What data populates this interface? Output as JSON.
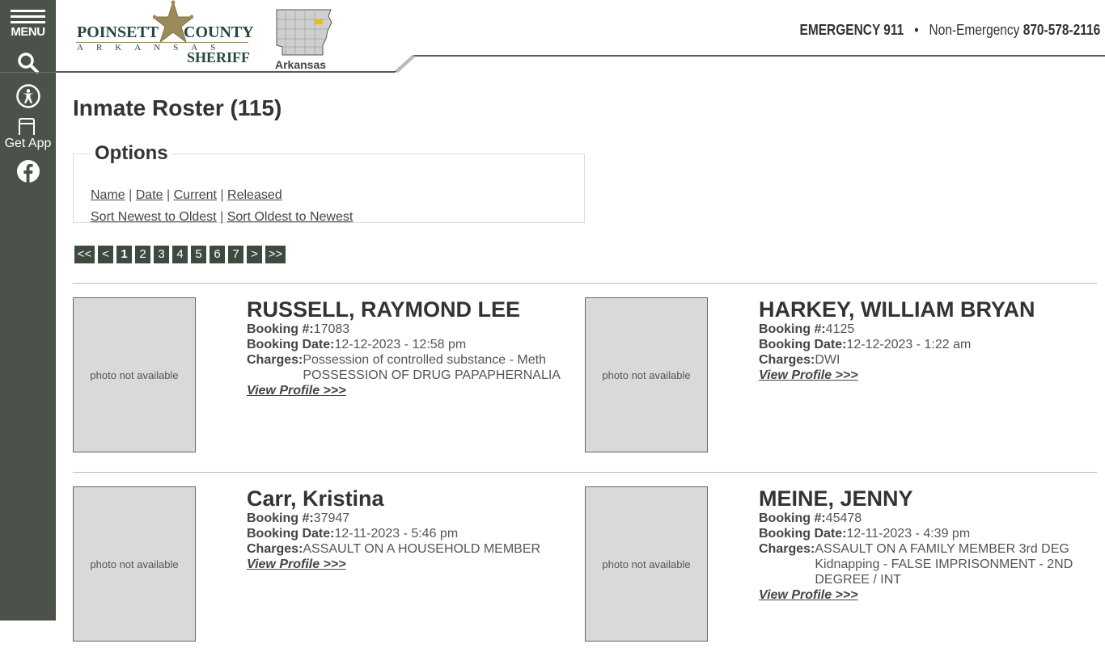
{
  "sidebar": {
    "menu_label": "MENU",
    "app_label": "Get App"
  },
  "header": {
    "logo": {
      "line1_left": "POINSETT",
      "line1_right": "COUNTY",
      "line2": "ARKANSAS",
      "line3": "SHERIFF"
    },
    "state_label": "Arkansas",
    "emergency_label": "EMERGENCY 911",
    "separator": "•",
    "non_emergency_label": "Non-Emergency",
    "non_emergency_number": "870-578-2116"
  },
  "page": {
    "title": "Inmate Roster (115)"
  },
  "options": {
    "legend": "Options",
    "filters": [
      "Name",
      "Date",
      "Current",
      "Released"
    ],
    "sorts": [
      "Sort Newest to Oldest",
      "Sort Oldest to Newest"
    ],
    "divider": "|"
  },
  "pager": {
    "items": [
      "<<",
      "<",
      "1",
      "2",
      "3",
      "4",
      "5",
      "6",
      "7",
      ">",
      ">>"
    ],
    "current": "1"
  },
  "labels": {
    "photo_na": "photo not available",
    "booking_no": "Booking #:",
    "booking_date": "Booking Date:",
    "charges": "Charges:",
    "view_profile": "View Profile >>>"
  },
  "inmates": [
    {
      "name": "RUSSELL, RAYMOND LEE",
      "booking_no": "17083",
      "booking_date": "12-12-2023 - 12:58 pm",
      "charges": [
        "Possession of controlled substance - Meth",
        "POSSESSION OF DRUG PAPAPHERNALIA"
      ]
    },
    {
      "name": "HARKEY, WILLIAM BRYAN",
      "booking_no": "4125",
      "booking_date": "12-12-2023 - 1:22 am",
      "charges": [
        "DWI"
      ]
    },
    {
      "name": "Carr, Kristina",
      "booking_no": "37947",
      "booking_date": "12-11-2023 - 5:46 pm",
      "charges": [
        "ASSAULT ON A HOUSEHOLD MEMBER"
      ]
    },
    {
      "name": "MEINE, JENNY",
      "booking_no": "45478",
      "booking_date": "12-11-2023 - 4:39 pm",
      "charges": [
        "ASSAULT ON A FAMILY MEMBER 3rd DEG",
        "Kidnapping - FALSE IMPRISONMENT - 2ND DEGREE / INT"
      ]
    }
  ]
}
